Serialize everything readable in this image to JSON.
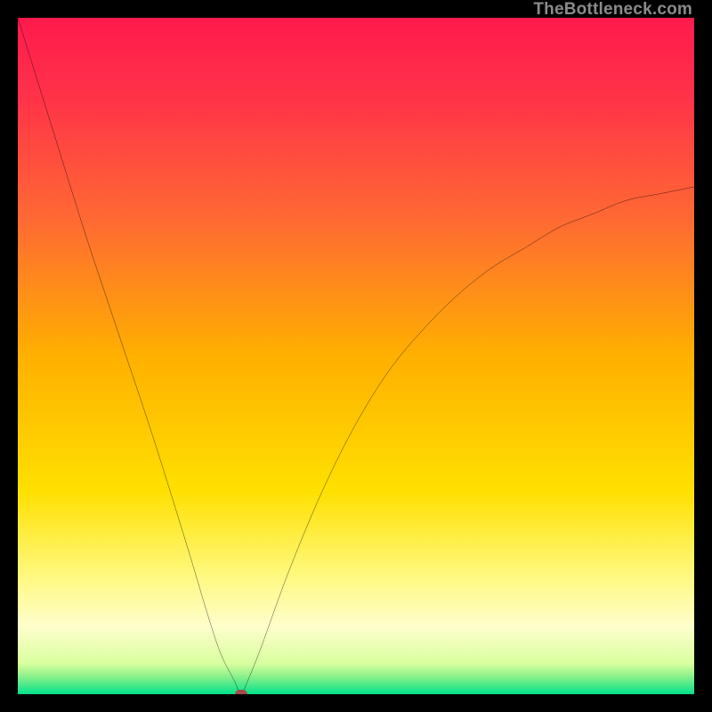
{
  "attribution": "TheBottleneck.com",
  "colors": {
    "frame_bg": "#000000",
    "gradient_stops": [
      {
        "offset": 0.0,
        "color": "#ff1a4d"
      },
      {
        "offset": 0.12,
        "color": "#ff3348"
      },
      {
        "offset": 0.3,
        "color": "#ff6a33"
      },
      {
        "offset": 0.5,
        "color": "#ffb000"
      },
      {
        "offset": 0.7,
        "color": "#ffe000"
      },
      {
        "offset": 0.82,
        "color": "#fff87a"
      },
      {
        "offset": 0.9,
        "color": "#fffecc"
      },
      {
        "offset": 0.955,
        "color": "#d8ff9e"
      },
      {
        "offset": 0.975,
        "color": "#86f08a"
      },
      {
        "offset": 1.0,
        "color": "#00e08a"
      }
    ],
    "curve": "#000000",
    "marker": "#a84a4a"
  },
  "chart_data": {
    "type": "line",
    "title": "",
    "xlabel": "",
    "ylabel": "",
    "xlim": [
      0,
      100
    ],
    "ylim": [
      0,
      100
    ],
    "series": [
      {
        "name": "bottleneck-curve",
        "x": [
          0,
          5,
          10,
          15,
          20,
          25,
          28,
          30,
          32,
          33,
          34,
          36,
          40,
          45,
          50,
          55,
          60,
          65,
          70,
          75,
          80,
          85,
          90,
          95,
          100
        ],
        "values": [
          100,
          84,
          68,
          53,
          38,
          22,
          12,
          6,
          2,
          0,
          2,
          7,
          18,
          30,
          40,
          48,
          54,
          59,
          63,
          66,
          69,
          71,
          73,
          74,
          75
        ]
      }
    ],
    "marker": {
      "x": 33,
      "y": 0,
      "name": "optimal-point"
    }
  }
}
